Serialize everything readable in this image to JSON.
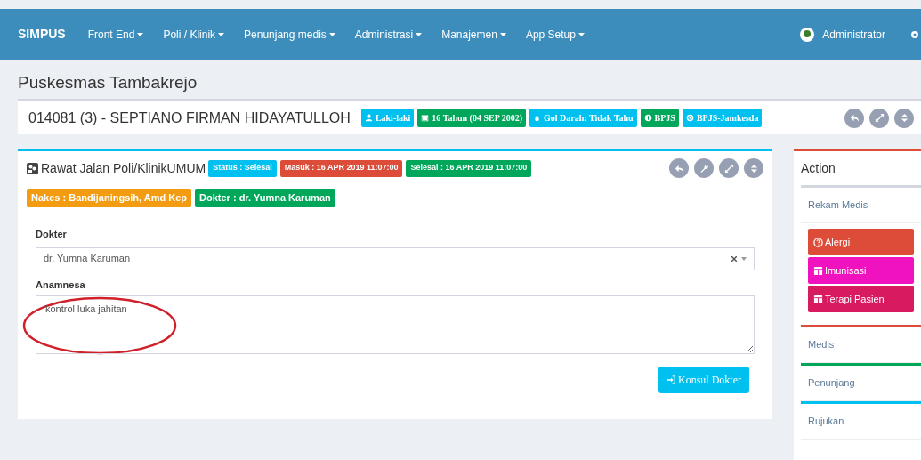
{
  "navbar": {
    "brand": "SIMPUS",
    "menus": [
      "Front End",
      "Poli / Klinik",
      "Penunjang medis",
      "Administrasi",
      "Manajemen",
      "App Setup"
    ],
    "user": "Administrator"
  },
  "page_title": "Puskesmas Tambakrejo",
  "patient": {
    "title": "014081 (3) - SEPTIANO FIRMAN HIDAYATULLOH",
    "badges": [
      {
        "kind": "user",
        "label": "Laki-laki",
        "color": "#00c0ef"
      },
      {
        "kind": "calendar",
        "label": "16 Tahun (04 SEP 2002)",
        "color": "#00a65a"
      },
      {
        "kind": "drop",
        "label": "Gol Darah: Tidak Tahu",
        "color": "#00c0ef"
      },
      {
        "kind": "info",
        "label": "BPJS",
        "color": "#00a65a"
      },
      {
        "kind": "target",
        "label": "BPJS-Jamkesda",
        "color": "#00c0ef"
      }
    ],
    "tools": [
      {
        "kind": "undo"
      },
      {
        "kind": "expand"
      },
      {
        "kind": "updown"
      }
    ]
  },
  "visit": {
    "title": "Rawat Jalan Poli/KlinikUMUM",
    "badges": [
      {
        "label": "Status : Selesai",
        "color": "#00c0ef"
      },
      {
        "label": "Masuk : 16 APR 2019 11:07:00",
        "color": "#dd4b39"
      },
      {
        "label": "Selesai : 16 APR 2019 11:07:00",
        "color": "#00a65a"
      }
    ],
    "tools": [
      {
        "kind": "undo"
      },
      {
        "kind": "wrench"
      },
      {
        "kind": "expand"
      },
      {
        "kind": "updown"
      }
    ],
    "tags": [
      {
        "label": "Nakes : Bandijaningsih, Amd Kep",
        "color": "#f39c12"
      },
      {
        "label": "Dokter : dr. Yumna Karuman",
        "color": "#00a65a"
      }
    ],
    "dokter": {
      "label": "Dokter",
      "value": "dr. Yumna Karuman"
    },
    "anamnesa": {
      "label": "Anamnesa",
      "value": "kontrol luka jahitan"
    },
    "button": "Konsul Dokter"
  },
  "action": {
    "title": "Action",
    "sections": [
      {
        "label": "Rekam Medis",
        "color": "#d2d6de",
        "buttons": [
          {
            "kind": "question",
            "label": "Alergi",
            "color": "#dd4b39"
          },
          {
            "kind": "table",
            "label": "Imunisasi",
            "color": "#f012be"
          },
          {
            "kind": "table",
            "label": "Terapi Pasien",
            "color": "#d81b60"
          }
        ]
      },
      {
        "label": "Medis",
        "color": "#dd4b39"
      },
      {
        "label": "Penunjang",
        "color": "#00a65a"
      },
      {
        "label": "Rujukan",
        "color": "#00c0ef"
      }
    ]
  }
}
